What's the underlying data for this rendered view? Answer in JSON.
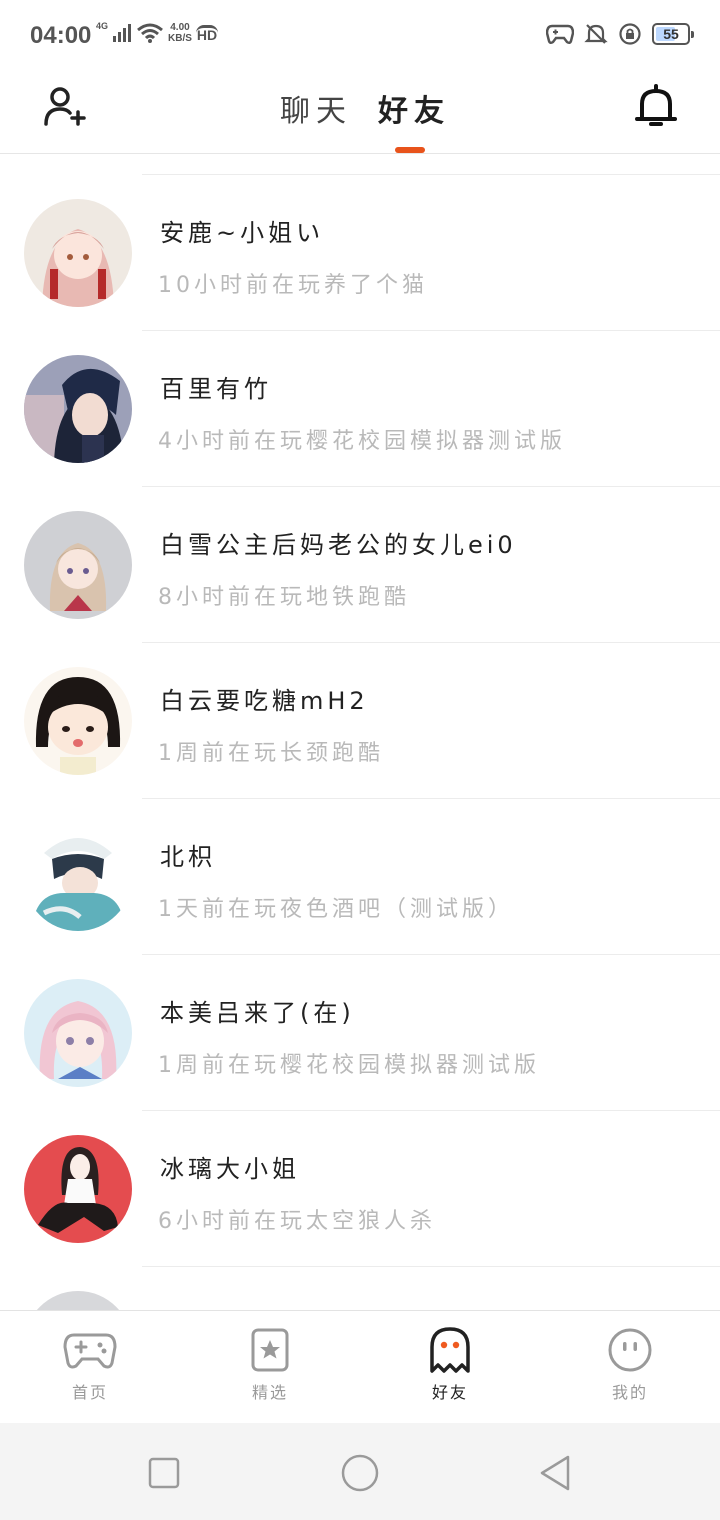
{
  "status_bar": {
    "time": "04:00",
    "signal_label": "4G",
    "net_speed_value": "4.00",
    "net_speed_unit": "KB/S",
    "hd_label": "HD",
    "battery_level": "55",
    "icons": [
      "signal-icon",
      "wifi-icon",
      "gamepad-icon",
      "mute-bell-icon",
      "rotation-lock-icon",
      "battery-icon"
    ]
  },
  "header": {
    "tabs": [
      {
        "label": "聊天",
        "active": false
      },
      {
        "label": "好友",
        "active": true
      }
    ],
    "left_icon": "add-friend-icon",
    "right_icon": "bell-icon"
  },
  "friends": [
    {
      "name": "安鹿~小姐い",
      "activity": "10小时前在玩养了个猫",
      "avatar_color": "#f2d6cf"
    },
    {
      "name": "百里有竹",
      "activity": "4小时前在玩樱花校园模拟器测试版",
      "avatar_color": "#26334f"
    },
    {
      "name": "白雪公主后妈老公的女儿ei0",
      "activity": "8小时前在玩地铁跑酷",
      "avatar_color": "#cfd0d4"
    },
    {
      "name": "白云要吃糖mH2",
      "activity": "1周前在玩长颈跑酷",
      "avatar_color": "#fbf3e6"
    },
    {
      "name": "北枳",
      "activity": "1天前在玩夜色酒吧（测试版）",
      "avatar_color": "#5fb0bb"
    },
    {
      "name": "本美吕来了(在)",
      "activity": "1周前在玩樱花校园模拟器测试版",
      "avatar_color": "#f1d8e3"
    },
    {
      "name": "冰璃大小姐",
      "activity": "6小时前在玩太空狼人杀",
      "avatar_color": "#e44c4f"
    },
    {
      "name": "",
      "activity": "",
      "avatar_color": "#d7d8db"
    }
  ],
  "bottom_nav": {
    "items": [
      {
        "label": "首页",
        "icon": "gamepad-icon",
        "active": false
      },
      {
        "label": "精选",
        "icon": "star-bookmark-icon",
        "active": false
      },
      {
        "label": "好友",
        "icon": "ghost-icon",
        "active": true
      },
      {
        "label": "我的",
        "icon": "smiley-face-icon",
        "active": false
      }
    ],
    "accent_color": "#ef5a1f"
  },
  "system_nav": {
    "buttons": [
      "recent-apps-icon",
      "home-icon",
      "back-icon"
    ]
  }
}
